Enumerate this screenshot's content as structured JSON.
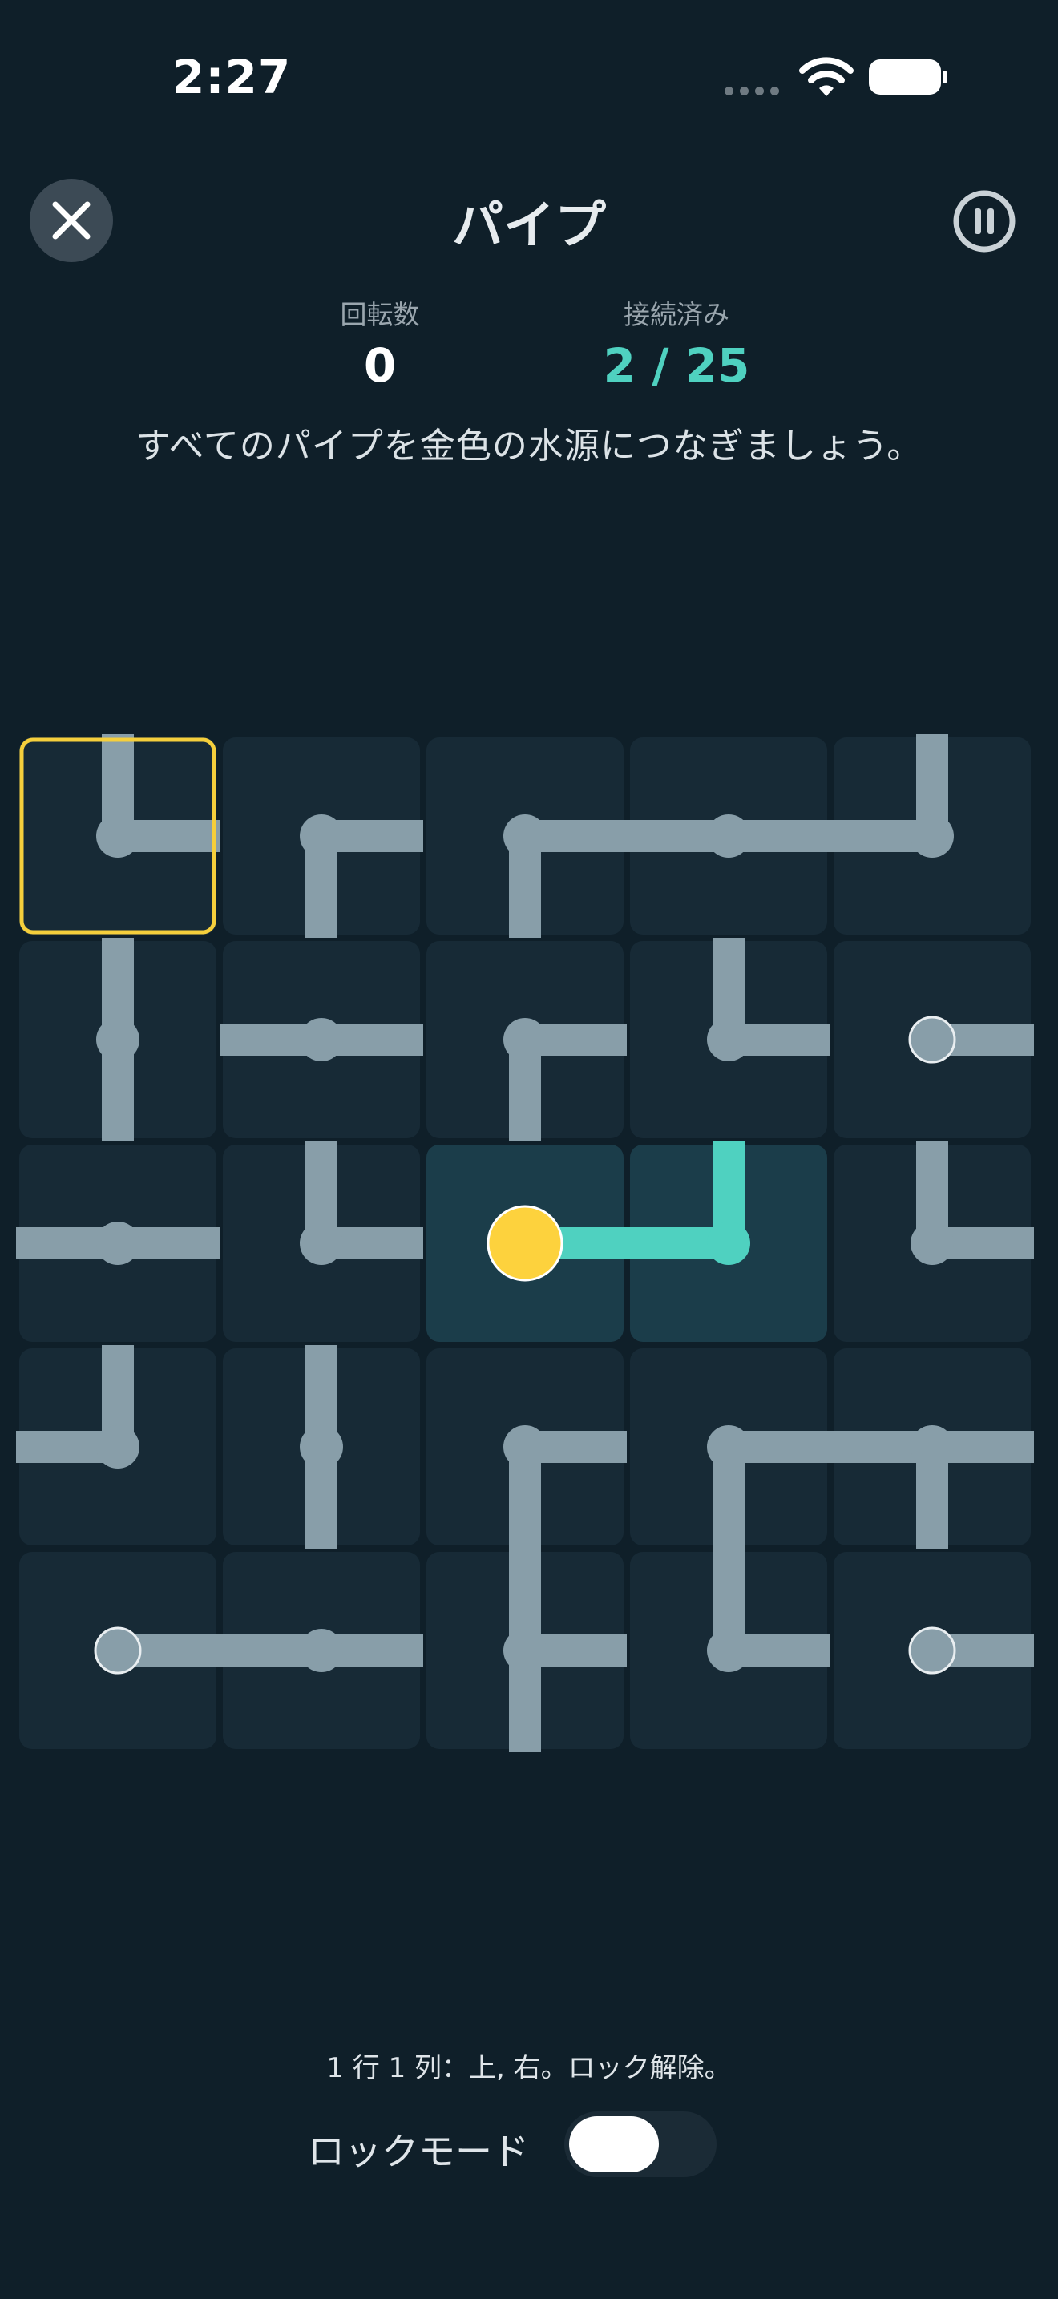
{
  "status_bar": {
    "time": "2:27"
  },
  "header": {
    "title": "パイプ",
    "close_icon": "close-x-icon",
    "pause_icon": "pause-circle-icon"
  },
  "stats": {
    "rotations_label": "回転数",
    "rotations_value": "0",
    "connected_label": "接続済み",
    "connected_value": "2 / 25"
  },
  "instruction": "すべてのパイプを金色の水源につなぎましょう。",
  "colors": {
    "background": "#0f1f29",
    "cell": "#172a36",
    "cell_connected": "#1b3d4a",
    "pipe": "#889ea9",
    "pipe_connected": "#4fd1c0",
    "source": "#fdd23d",
    "selection": "#f5cf3c"
  },
  "board": {
    "rows": 5,
    "cols": 5,
    "selected": [
      0,
      0
    ],
    "source": [
      2,
      2
    ],
    "tiles": [
      [
        {
          "c": [
            "u",
            "r"
          ]
        },
        {
          "c": [
            "d",
            "r"
          ]
        },
        {
          "c": [
            "d",
            "r"
          ]
        },
        {
          "c": [
            "l",
            "r"
          ]
        },
        {
          "c": [
            "u",
            "l"
          ]
        }
      ],
      [
        {
          "c": [
            "u",
            "d"
          ]
        },
        {
          "c": [
            "l",
            "r"
          ]
        },
        {
          "c": [
            "d",
            "r"
          ]
        },
        {
          "c": [
            "u",
            "r"
          ]
        },
        {
          "c": [
            "r"
          ],
          "end": true
        }
      ],
      [
        {
          "c": [
            "l",
            "r"
          ]
        },
        {
          "c": [
            "u",
            "r"
          ]
        },
        {
          "c": [
            "r"
          ],
          "source": true,
          "on": true
        },
        {
          "c": [
            "u",
            "l"
          ],
          "on": true
        },
        {
          "c": [
            "u",
            "r"
          ]
        }
      ],
      [
        {
          "c": [
            "u",
            "l"
          ]
        },
        {
          "c": [
            "u",
            "d"
          ]
        },
        {
          "c": [
            "d",
            "r"
          ]
        },
        {
          "c": [
            "d",
            "r"
          ]
        },
        {
          "c": [
            "l",
            "r",
            "d"
          ]
        }
      ],
      [
        {
          "c": [
            "r"
          ],
          "end": true
        },
        {
          "c": [
            "l",
            "r"
          ]
        },
        {
          "c": [
            "u",
            "r",
            "d"
          ]
        },
        {
          "c": [
            "u",
            "r"
          ]
        },
        {
          "c": [
            "r"
          ],
          "end": true
        }
      ]
    ]
  },
  "footer": {
    "cell_info": "1 行 1 列：上, 右。ロック解除。",
    "lock_mode_label": "ロックモード",
    "lock_mode_on": false
  }
}
